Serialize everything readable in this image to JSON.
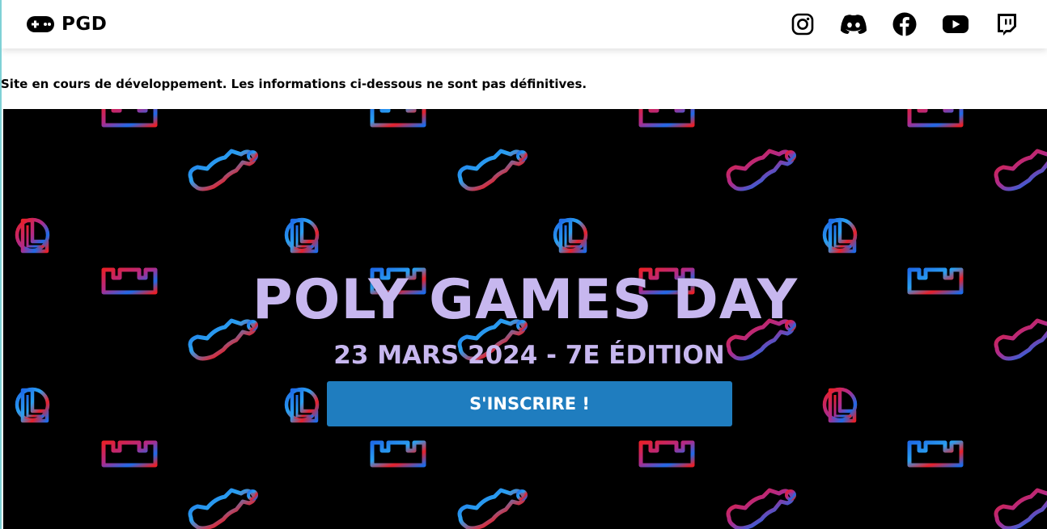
{
  "navbar": {
    "brand_name": "PGD",
    "brand_icon": "gamepad-icon",
    "socials": [
      {
        "name": "instagram-icon"
      },
      {
        "name": "discord-icon"
      },
      {
        "name": "facebook-icon"
      },
      {
        "name": "youtube-icon"
      },
      {
        "name": "twitch-icon"
      }
    ]
  },
  "notice": "Site en cours de développement. Les informations ci-dessous ne sont pas définitives.",
  "hero": {
    "title": "POLY GAMES DAY",
    "subtitle": "23 MARS 2024 - 7E ÉDITION",
    "cta_label": "S'INSCRIRE !",
    "pattern_icons": [
      "crown-icon",
      "race-track-icon",
      "league-logo-icon"
    ]
  },
  "colors": {
    "title": "#c7b7ef",
    "cta": "#1f7dbf",
    "hero_bg": "#000000",
    "neon_red": "#e8202a",
    "neon_blue": "#1e6be8"
  }
}
